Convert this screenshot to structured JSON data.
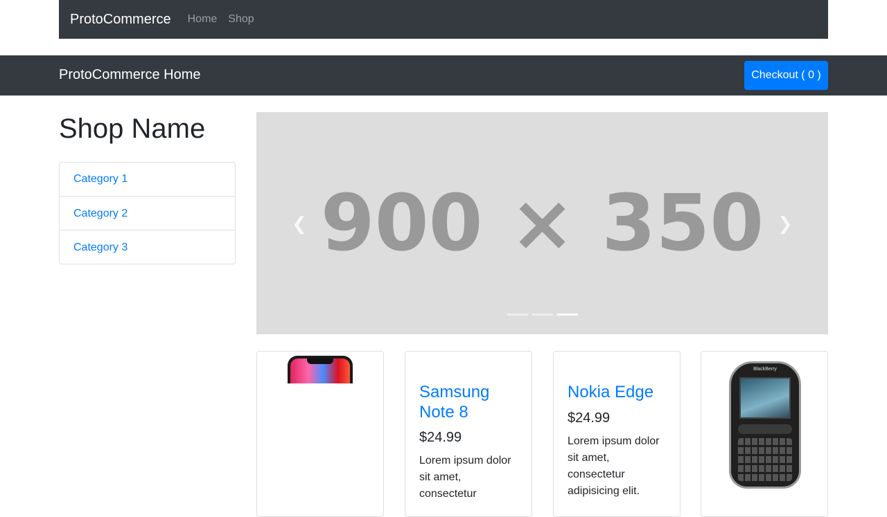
{
  "topnav": {
    "brand": "ProtoCommerce",
    "links": [
      "Home",
      "Shop"
    ]
  },
  "subnav": {
    "brand": "ProtoCommerce Home",
    "checkout_label": "Checkout ( 0 )"
  },
  "sidebar": {
    "shop_name": "Shop Name",
    "categories": [
      "Category 1",
      "Category 2",
      "Category 3"
    ]
  },
  "carousel": {
    "placeholder_text": "900 × 350",
    "prev_icon": "chevron-left-icon",
    "next_icon": "chevron-right-icon",
    "indicator_count": 3,
    "active_indicator": 3
  },
  "products": [
    {
      "image": "iphone-image"
    },
    {
      "title": "Samsung Note 8",
      "price": "$24.99",
      "description": "Lorem ipsum dolor sit amet, consectetur"
    },
    {
      "title": "Nokia Edge",
      "price": "$24.99",
      "description": "Lorem ipsum dolor sit amet, consectetur adipisicing elit."
    },
    {
      "image": "blackberry-image",
      "brand_text": "BlackBerry"
    }
  ],
  "colors": {
    "navbar": "#343a40",
    "primary": "#007bff",
    "carousel_bg": "#dddddd",
    "carousel_text": "#999999"
  }
}
